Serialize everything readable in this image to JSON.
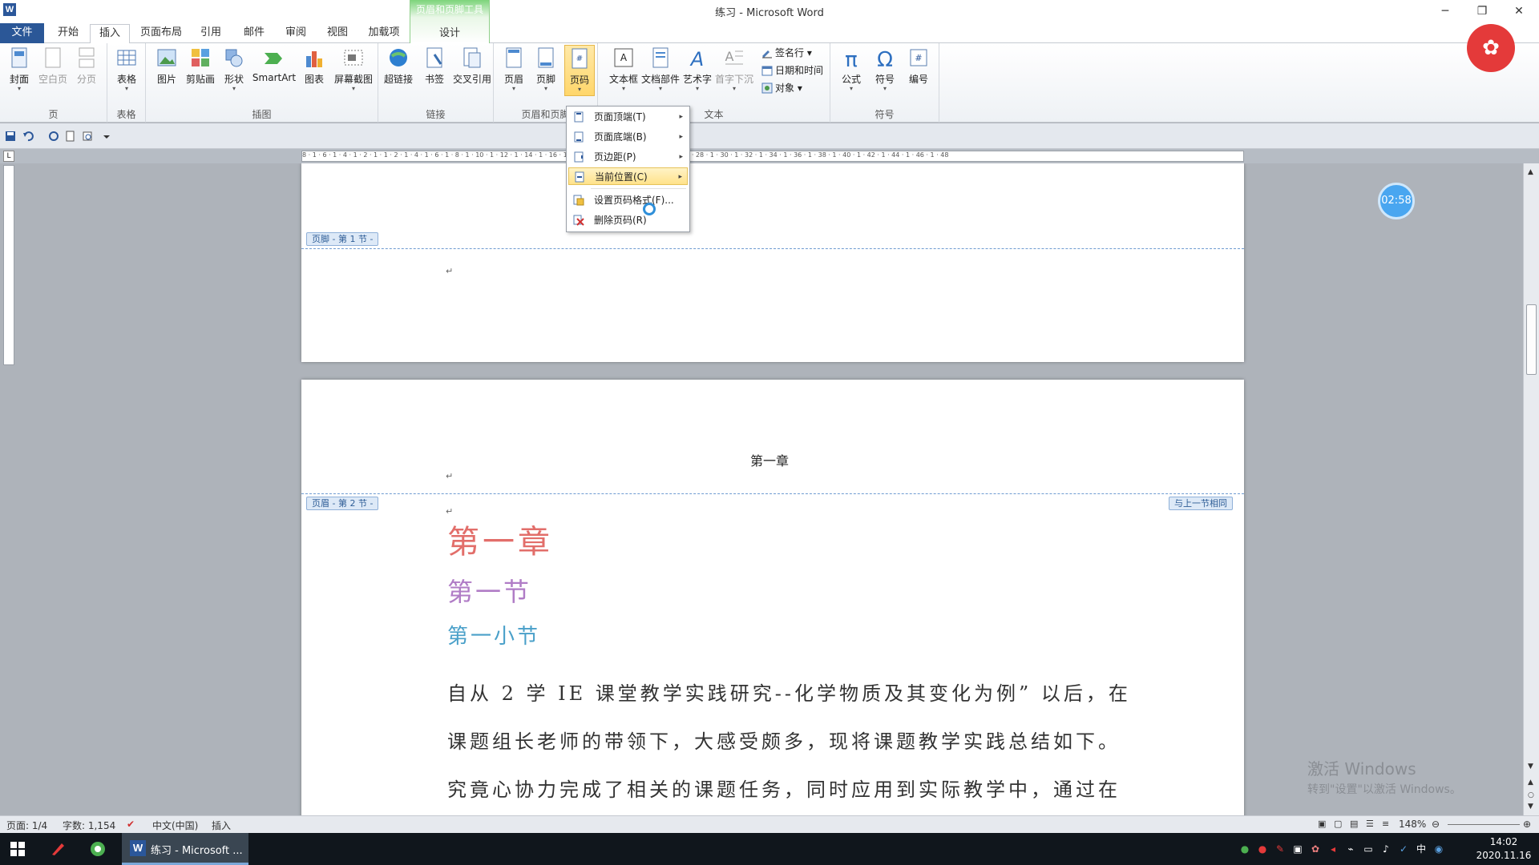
{
  "window": {
    "title": "练习 - Microsoft Word",
    "app_letter": "W",
    "minimize": "─",
    "restore": "❐",
    "close": "✕"
  },
  "tabs": [
    {
      "label": "文件"
    },
    {
      "label": "开始"
    },
    {
      "label": "插入"
    },
    {
      "label": "页面布局"
    },
    {
      "label": "引用"
    },
    {
      "label": "邮件"
    },
    {
      "label": "审阅"
    },
    {
      "label": "视图"
    },
    {
      "label": "加载项"
    }
  ],
  "context_tool": {
    "title": "页眉和页脚工具",
    "tab": "设计"
  },
  "ribbon": {
    "groups": {
      "pages": "页",
      "table": "表格",
      "illustrations": "插图",
      "links": "链接",
      "header_footer": "页眉和页脚",
      "text": "文本",
      "symbols": "符号"
    },
    "buttons": {
      "cover": "封面",
      "blank": "空白页",
      "break": "分页",
      "table": "表格",
      "picture": "图片",
      "clipart": "剪贴画",
      "shapes": "形状",
      "smartart": "SmartArt",
      "chart": "图表",
      "screenshot": "屏幕截图",
      "hyperlink": "超链接",
      "bookmark": "书签",
      "crossref": "交叉引用",
      "header": "页眉",
      "footer": "页脚",
      "pagenum": "页码",
      "textbox": "文本框",
      "quickparts": "文档部件",
      "wordart": "艺术字",
      "dropcap": "首字下沉",
      "signature": "签名行",
      "datetime": "日期和时间",
      "object": "对象",
      "equation": "公式",
      "symbol": "符号",
      "number": "编号"
    }
  },
  "dropdown": {
    "items": [
      {
        "label": "页面顶端(T)",
        "arrow": "▸"
      },
      {
        "label": "页面底端(B)",
        "arrow": "▸"
      },
      {
        "label": "页边距(P)",
        "arrow": "▸"
      },
      {
        "label": "当前位置(C)",
        "arrow": "▸"
      },
      {
        "label": "设置页码格式(F)..."
      },
      {
        "label": "删除页码(R)"
      }
    ]
  },
  "ruler": {
    "ticks": "8 · 1 · 6 · 1 · 4 · 1 · 2 · 1 · 1 · 2 · 1 · 4 · 1 · 6 · 1 · 8 · 1 · 10 · 1 · 12 · 1 · 14 · 1 · 16 · 1 · 18 · 1 · 20 · 1 · 22 · 1 · 24 · 1 · 26 · 1 · 28 · 1 · 30 · 1 · 32 · 1 · 34 · 1 · 36 · 1 · 38 · 1 · 40 · 1 · 42 · 1 · 44 · 1 · 46 · 1 · 48",
    "corner": "L"
  },
  "document": {
    "page1_footer_tag": "页脚 - 第 1 节 -",
    "page2_header_tag": "页眉 - 第 2 节 -",
    "same_as_previous": "与上一节相同",
    "header_text": "第一章",
    "para_mark": "↵",
    "heading1": "第一章",
    "heading2": "第一节",
    "heading3": "第一小节",
    "body_lines": [
      "自从 2 学 IE 课堂教学实践研究--化学物质及其变化为例” 以后，在",
      "课题组长老师的带领下，大感受颇多，现将课题教学实践总结如下。",
      "究竟心协力完成了相关的课题任务，同时应用到实际教学中，通过在"
    ]
  },
  "timer": "02:58",
  "watermark": {
    "line1": "激活 Windows",
    "line2": "转到\"设置\"以激活 Windows。"
  },
  "status": {
    "page": "页面: 1/4",
    "words": "字数: 1,154",
    "language": "中文(中国)",
    "mode": "插入",
    "zoom": "148%"
  },
  "taskbar": {
    "word_label": "练习 - Microsoft ...",
    "time": "14:02",
    "date": "2020.11.16",
    "ime": "中"
  },
  "colors": {
    "accent": "#2b579a",
    "heading1": "#e26e6a",
    "heading2": "#b07cc6",
    "heading3": "#4aa0c9"
  }
}
